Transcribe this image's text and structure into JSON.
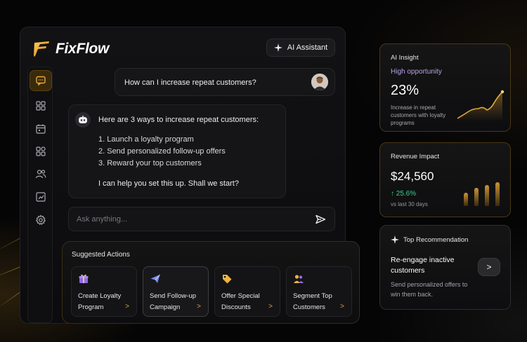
{
  "app": {
    "brand": "FixFlow",
    "ai_assistant_label": "AI Assistant",
    "nav_icons": [
      "chat-icon",
      "grid-icon",
      "calendar-icon",
      "apps-icon",
      "users-icon",
      "chart-icon",
      "gear-icon"
    ],
    "accent_color": "#d9a13a"
  },
  "chat": {
    "user_question": "How can I increase repeat customers?",
    "ai_intro": "Here are 3 ways to increase repeat customers:",
    "ai_items": [
      "1. Launch a loyalty program",
      "2. Send personalized follow-up offers",
      "3. Reward your top customers"
    ],
    "ai_outro": "I can help you set this up. Shall we start?",
    "input_placeholder": "Ask anything..."
  },
  "suggested": {
    "title": "Suggested Actions",
    "actions": [
      {
        "label": "Create Loyalty Program",
        "icon": "gift-icon",
        "arrow": ">"
      },
      {
        "label": "Send Follow-up Campaign",
        "icon": "send-icon",
        "arrow": ">"
      },
      {
        "label": "Offer Special Discounts",
        "icon": "tag-icon",
        "arrow": ">"
      },
      {
        "label": "Segment Top Customers",
        "icon": "users-icon",
        "arrow": ">"
      }
    ]
  },
  "insight": {
    "title": "AI Insight",
    "subtitle": "High opportunity",
    "value": "23%",
    "description": "Increase in repeat customers with loyalty programs"
  },
  "revenue": {
    "title": "Revenue Impact",
    "value": "$24,560",
    "change": "↑ 25.6%",
    "period": "vs last 30 days"
  },
  "recommendation": {
    "title": "Top Recommendation",
    "headline": "Re-engage inactive customers",
    "detail": "Send personalized offers to win them back.",
    "button": ">"
  }
}
